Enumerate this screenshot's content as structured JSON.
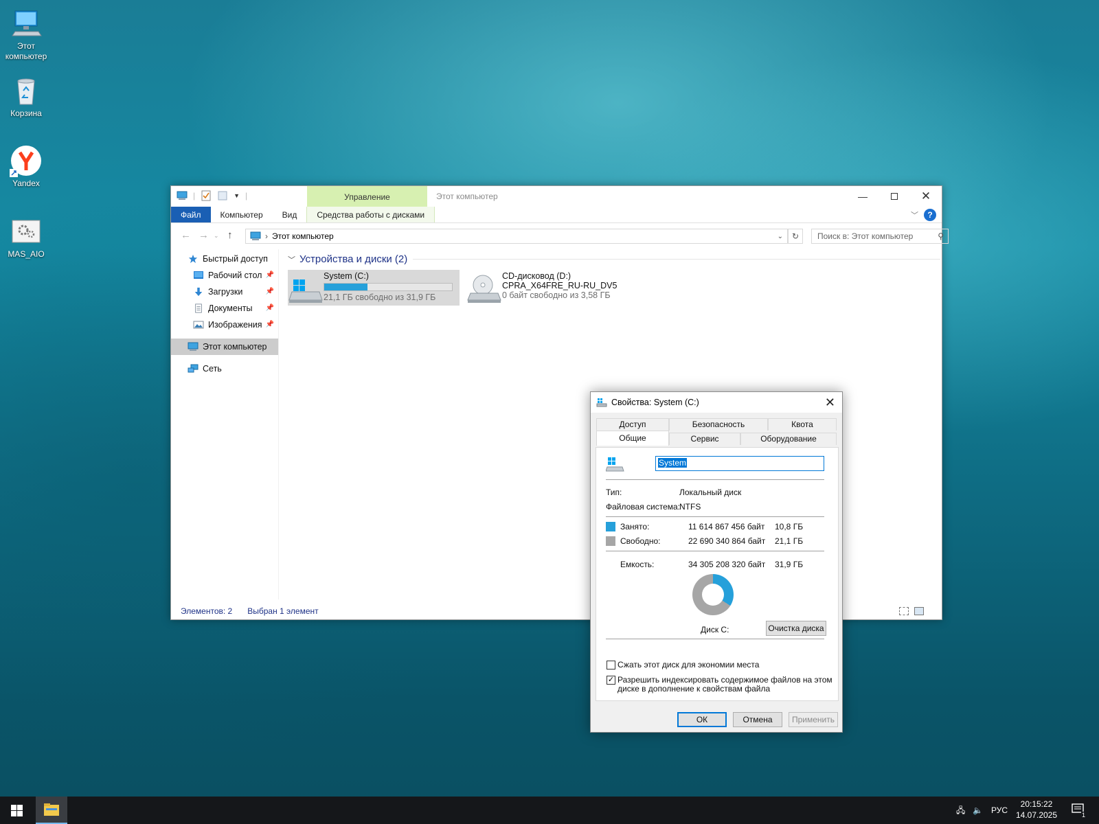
{
  "desktop": {
    "icons": [
      {
        "label": "Этот\nкомпьютер",
        "icon": "computer-icon"
      },
      {
        "label": "Корзина",
        "icon": "recycle-bin-icon"
      },
      {
        "label": "Yandex",
        "icon": "yandex-browser-icon"
      },
      {
        "label": "MAS_AIO",
        "icon": "settings-script-icon"
      }
    ]
  },
  "explorer": {
    "title": "Этот компьютер",
    "manage_tab": "Управление",
    "ribbon_tabs": [
      "Файл",
      "Компьютер",
      "Вид",
      "Средства работы с дисками"
    ],
    "help": "?",
    "address_crumb": "Этот компьютер",
    "search_placeholder": "Поиск в: Этот компьютер",
    "sidebar": {
      "quick_access": "Быстрый доступ",
      "pinned": [
        "Рабочий стол",
        "Загрузки",
        "Документы",
        "Изображения"
      ],
      "this_pc": "Этот компьютер",
      "network": "Сеть"
    },
    "group_header": "Устройства и диски (2)",
    "drives": [
      {
        "name": "System (C:)",
        "line2": "",
        "free": "21,1 ГБ свободно из 31,9 ГБ",
        "used_fraction": 0.34
      },
      {
        "name": "CD-дисковод (D:)",
        "line2": "CPRA_X64FRE_RU-RU_DV5",
        "free": "0 байт свободно из 3,58 ГБ"
      }
    ],
    "status": {
      "items": "Элементов: 2",
      "selected": "Выбран 1 элемент"
    }
  },
  "properties": {
    "title": "Свойства: System (C:)",
    "tabs_top": [
      "Доступ",
      "Безопасность",
      "Квота"
    ],
    "tabs_bottom": [
      "Общие",
      "Сервис",
      "Оборудование"
    ],
    "volume_name": "System",
    "type_label": "Тип:",
    "type_value": "Локальный диск",
    "fs_label": "Файловая система:",
    "fs_value": "NTFS",
    "used_label": "Занято:",
    "used_bytes": "11 614 867 456 байт",
    "used_gb": "10,8 ГБ",
    "free_label": "Свободно:",
    "free_bytes": "22 690 340 864 байт",
    "free_gb": "21,1 ГБ",
    "capacity_label": "Емкость:",
    "capacity_bytes": "34 305 208 320 байт",
    "capacity_gb": "31,9 ГБ",
    "disk_label": "Диск C:",
    "cleanup_button": "Очистка диска",
    "compress_label": "Сжать этот диск для экономии места",
    "compress_checked": false,
    "index_label_1": "Разрешить индексировать содержимое файлов на этом",
    "index_label_2": "диске в дополнение к свойствам файла",
    "index_checked": true,
    "ok": "ОК",
    "cancel": "Отмена",
    "apply": "Применить",
    "used_fraction": 0.34,
    "colors": {
      "used": "#26a0da",
      "free": "#a6a6a6"
    }
  },
  "taskbar": {
    "lang": "РУС",
    "time": "20:15:22",
    "date": "14.07.2025",
    "notifications": "1"
  }
}
